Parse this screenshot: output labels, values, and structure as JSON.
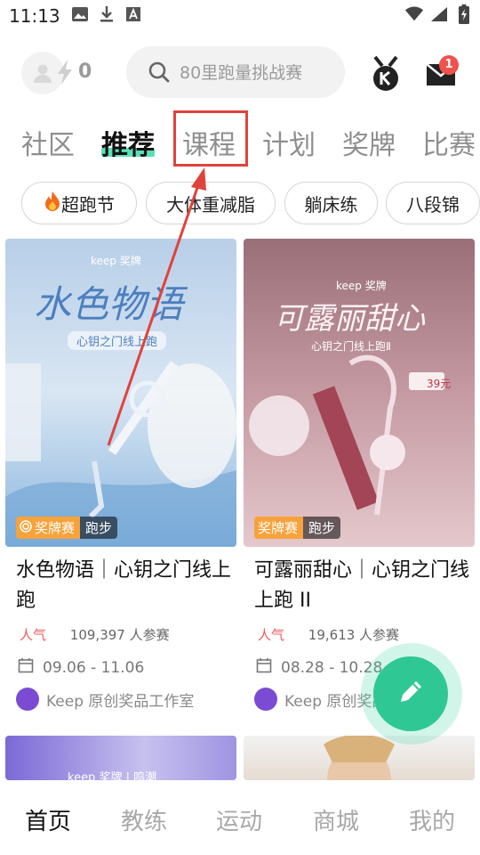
{
  "status_bar": {
    "time": "11:13",
    "icons": [
      "image-icon",
      "download-icon",
      "font-a-icon",
      "wifi-icon",
      "signal-icon",
      "battery-charging-icon"
    ]
  },
  "header": {
    "user_count": "0",
    "search_placeholder": "80里跑量挑战赛",
    "mail_badge": "1"
  },
  "tabs": [
    {
      "label": "社区",
      "active": false
    },
    {
      "label": "推荐",
      "active": true
    },
    {
      "label": "课程",
      "active": false
    },
    {
      "label": "计划",
      "active": false
    },
    {
      "label": "奖牌",
      "active": false
    },
    {
      "label": "比赛",
      "active": false
    }
  ],
  "chips": [
    {
      "label": "超跑节",
      "icon": "fire-icon"
    },
    {
      "label": "大体重减脂"
    },
    {
      "label": "躺床练"
    },
    {
      "label": "八段锦"
    }
  ],
  "cards": [
    {
      "image_title": "水色物语",
      "image_subtitle": "心钥之门线上跑",
      "brand": "keep 奖牌",
      "tag_primary": "奖牌赛",
      "tag_secondary": "跑步",
      "title": "水色物语｜心钥之门线上跑",
      "pop_label": "人气",
      "participants": "109,397 人参赛",
      "dates": "09.06 - 11.06",
      "author": "Keep 原创奖品工作室"
    },
    {
      "image_title": "可露丽甜心",
      "image_subtitle": "心钥之门线上跑Ⅱ",
      "brand": "keep 奖牌",
      "price": "39元",
      "tag_primary": "奖牌赛",
      "tag_secondary": "跑步",
      "title": "可露丽甜心｜心钥之门线上跑 II",
      "pop_label": "人气",
      "participants": "19,613 人参赛",
      "dates": "08.28 - 10.28",
      "author": "Keep 原创奖品"
    }
  ],
  "more_cards": [
    {
      "image_text": "keep 奖牌 | 鸣潮"
    },
    {
      "image_text": ""
    }
  ],
  "bottom_nav": [
    {
      "label": "首页",
      "active": true
    },
    {
      "label": "教练",
      "active": false
    },
    {
      "label": "运动",
      "active": false
    },
    {
      "label": "商城",
      "active": false
    },
    {
      "label": "我的",
      "active": false
    }
  ],
  "colors": {
    "accent_green": "#2fc894",
    "tab_underline": "#59e0b8",
    "highlight_red": "#e0433c",
    "tag_orange": "#f7a23b",
    "popularity_red": "#f05a5a"
  }
}
